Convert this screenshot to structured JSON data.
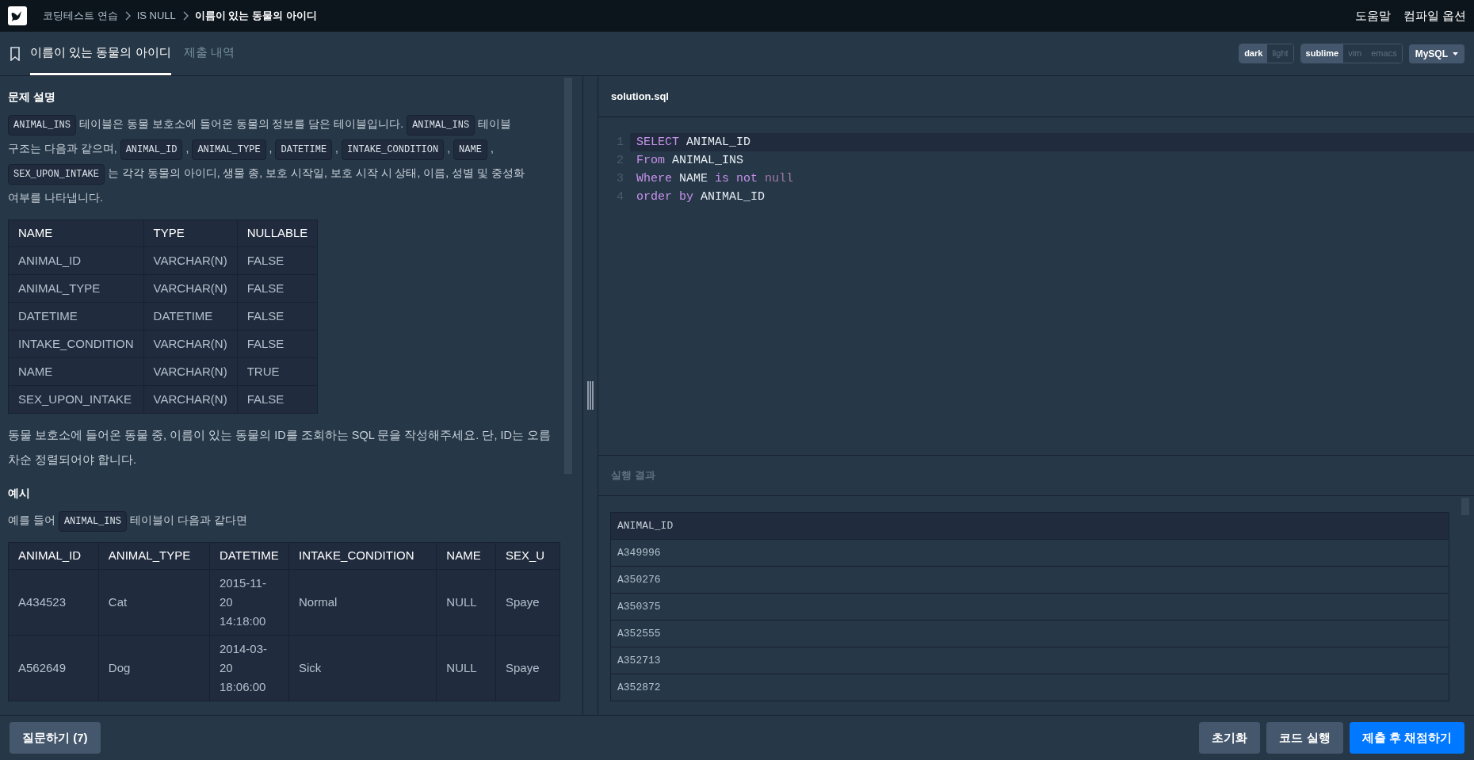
{
  "breadcrumb": [
    {
      "label": "코딩테스트 연습",
      "current": false
    },
    {
      "label": "IS NULL",
      "current": false
    },
    {
      "label": "이름이 있는 동물의 아이디",
      "current": true
    }
  ],
  "top_links": [
    "도움말",
    "컴파일 옵션"
  ],
  "tabs": [
    {
      "label": "이름이 있는 동물의 아이디",
      "selected": true
    },
    {
      "label": "제출 내역",
      "selected": false
    }
  ],
  "theme_toggle": [
    {
      "label": "dark",
      "selected": true
    },
    {
      "label": "light",
      "selected": false
    }
  ],
  "keymap_toggle": [
    {
      "label": "sublime",
      "selected": true
    },
    {
      "label": "vim",
      "selected": false
    },
    {
      "label": "emacs",
      "selected": false
    }
  ],
  "language": "MySQL",
  "problem": {
    "heading": "문제 설명",
    "intro": [
      {
        "kind": "code",
        "text": "ANIMAL_INS"
      },
      {
        "kind": "text",
        "text": "테이블은 동물 보호소에 들어온 동물의 정보를 담은 테이블입니다."
      },
      {
        "kind": "code",
        "text": "ANIMAL_INS"
      },
      {
        "kind": "text",
        "text": "테이블"
      },
      {
        "kind": "text",
        "text": "구조는 다음과 같으며,"
      },
      {
        "kind": "code",
        "text": "ANIMAL_ID"
      },
      {
        "kind": "text",
        "text": ","
      },
      {
        "kind": "code",
        "text": "ANIMAL_TYPE"
      },
      {
        "kind": "text",
        "text": ","
      },
      {
        "kind": "code",
        "text": "DATETIME"
      },
      {
        "kind": "text",
        "text": ","
      },
      {
        "kind": "code",
        "text": "INTAKE_CONDITION"
      },
      {
        "kind": "text",
        "text": ","
      },
      {
        "kind": "code",
        "text": "NAME"
      },
      {
        "kind": "text",
        "text": ","
      },
      {
        "kind": "code",
        "text": "SEX_UPON_INTAKE"
      },
      {
        "kind": "text",
        "text": "는 각각 동물의 아이디, 생물 종, 보호 시작일, 보호 시작 시 상태, 이름, 성별 및 중성화"
      },
      {
        "kind": "text",
        "text": "여부를 나타냅니다."
      }
    ],
    "schema_table": {
      "columns": [
        "NAME",
        "TYPE",
        "NULLABLE"
      ],
      "rows": [
        [
          "ANIMAL_ID",
          "VARCHAR(N)",
          "FALSE"
        ],
        [
          "ANIMAL_TYPE",
          "VARCHAR(N)",
          "FALSE"
        ],
        [
          "DATETIME",
          "DATETIME",
          "FALSE"
        ],
        [
          "INTAKE_CONDITION",
          "VARCHAR(N)",
          "FALSE"
        ],
        [
          "NAME",
          "VARCHAR(N)",
          "TRUE"
        ],
        [
          "SEX_UPON_INTAKE",
          "VARCHAR(N)",
          "FALSE"
        ]
      ]
    },
    "task": "동물 보호소에 들어온 동물 중, 이름이 있는 동물의 ID를 조회하는 SQL 문을 작성해주세요. 단, ID는 오름차순 정렬되어야 합니다.",
    "example_heading": "예시",
    "example_intro": [
      {
        "kind": "text",
        "text": "예를 들어"
      },
      {
        "kind": "code",
        "text": "ANIMAL_INS"
      },
      {
        "kind": "text",
        "text": "테이블이 다음과 같다면"
      }
    ],
    "example_table": {
      "columns": [
        "ANIMAL_ID",
        "ANIMAL_TYPE",
        "DATETIME",
        "INTAKE_CONDITION",
        "NAME",
        "SEX_U"
      ],
      "rows": [
        [
          "A434523",
          "Cat",
          "2015-11-20 14:18:00",
          "Normal",
          "NULL",
          "Spaye"
        ],
        [
          "A562649",
          "Dog",
          "2014-03-20 18:06:00",
          "Sick",
          "NULL",
          "Spaye"
        ]
      ]
    }
  },
  "editor": {
    "filename": "solution.sql",
    "lines": [
      {
        "number": "1",
        "current": true,
        "tokens": [
          {
            "kind": "keyword",
            "text": "SELECT"
          },
          {
            "kind": "plain",
            "text": "ANIMAL_ID"
          }
        ]
      },
      {
        "number": "2",
        "current": false,
        "tokens": [
          {
            "kind": "keyword",
            "text": "From"
          },
          {
            "kind": "plain",
            "text": "ANIMAL_INS"
          }
        ]
      },
      {
        "number": "3",
        "current": false,
        "tokens": [
          {
            "kind": "keyword",
            "text": "Where"
          },
          {
            "kind": "plain",
            "text": "NAME"
          },
          {
            "kind": "keyword",
            "text": "is"
          },
          {
            "kind": "keyword",
            "text": "not"
          },
          {
            "kind": "literal",
            "text": "null"
          }
        ]
      },
      {
        "number": "4",
        "current": false,
        "tokens": [
          {
            "kind": "keyword",
            "text": "order"
          },
          {
            "kind": "keyword",
            "text": "by"
          },
          {
            "kind": "plain",
            "text": "ANIMAL_ID"
          }
        ]
      }
    ]
  },
  "result": {
    "heading": "실행 결과",
    "columns": [
      "ANIMAL_ID"
    ],
    "rows": [
      [
        "A349996"
      ],
      [
        "A350276"
      ],
      [
        "A350375"
      ],
      [
        "A352555"
      ],
      [
        "A352713"
      ],
      [
        "A352872"
      ]
    ]
  },
  "footer": {
    "ask_button": "질문하기 (7)",
    "buttons": [
      {
        "label": "초기화",
        "kind": "secondary"
      },
      {
        "label": "코드 실행",
        "kind": "secondary"
      },
      {
        "label": "제출 후 채점하기",
        "kind": "primary"
      }
    ]
  }
}
